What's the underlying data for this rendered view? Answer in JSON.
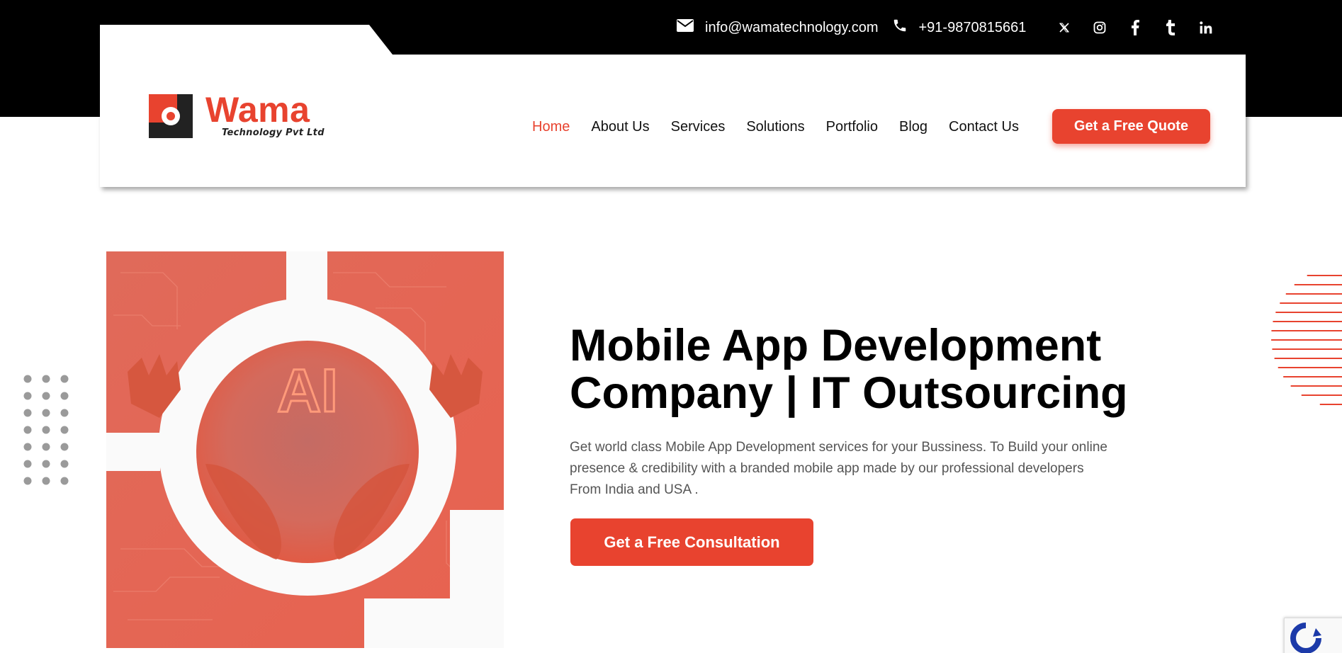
{
  "topbar": {
    "email": "info@wamatechnology.com",
    "phone": "+91-9870815661",
    "socials": [
      "x-icon",
      "instagram-icon",
      "facebook-icon",
      "tumblr-icon",
      "linkedin-icon"
    ]
  },
  "logo": {
    "name": "Wama",
    "subtitle": "Technology Pvt Ltd"
  },
  "nav": {
    "items": [
      "Home",
      "About Us",
      "Services",
      "Solutions",
      "Portfolio",
      "Blog",
      "Contact Us"
    ],
    "active": "Home",
    "quote_button": "Get a Free Quote"
  },
  "hero": {
    "image_text": "AI",
    "title_line1": "Mobile App Development",
    "title_line2": "Company | IT Outsourcing",
    "description": "Get world class Mobile App Development services for your Bussiness. To Build your online presence & credibility with a branded mobile app made by our professional developers From India and USA .",
    "cta": "Get a Free Consultation"
  },
  "colors": {
    "accent": "#e8432f",
    "topbar": "#000000",
    "text": "#111111",
    "muted": "#555555"
  }
}
